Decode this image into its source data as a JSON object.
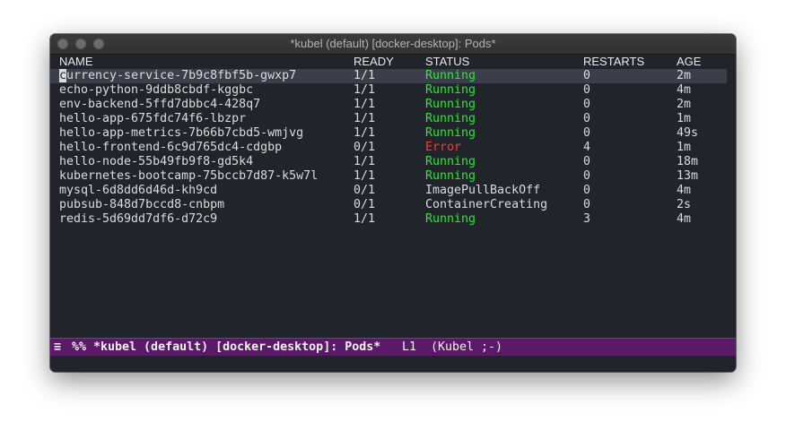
{
  "window": {
    "title": "*kubel (default) [docker-desktop]: Pods*"
  },
  "table": {
    "headers": {
      "name": "NAME",
      "ready": "READY",
      "status": "STATUS",
      "restarts": "RESTARTS",
      "age": "AGE"
    },
    "rows": [
      {
        "name_cursor": "c",
        "name_rest": "urrency-service-7b9c8fbf5b-gwxp7",
        "ready": "1/1",
        "status": "Running",
        "restarts": "0",
        "age": "2m"
      },
      {
        "name": "echo-python-9ddb8cbdf-kggbc",
        "ready": "1/1",
        "status": "Running",
        "restarts": "0",
        "age": "4m"
      },
      {
        "name": "env-backend-5ffd7dbbc4-428q7",
        "ready": "1/1",
        "status": "Running",
        "restarts": "0",
        "age": "2m"
      },
      {
        "name": "hello-app-675fdc74f6-lbzpr",
        "ready": "1/1",
        "status": "Running",
        "restarts": "0",
        "age": "1m"
      },
      {
        "name": "hello-app-metrics-7b66b7cbd5-wmjvg",
        "ready": "1/1",
        "status": "Running",
        "restarts": "0",
        "age": "49s"
      },
      {
        "name": "hello-frontend-6c9d765dc4-cdgbp",
        "ready": "0/1",
        "status": "Error",
        "restarts": "4",
        "age": "1m"
      },
      {
        "name": "hello-node-55b49fb9f8-gd5k4",
        "ready": "1/1",
        "status": "Running",
        "restarts": "0",
        "age": "18m"
      },
      {
        "name": "kubernetes-bootcamp-75bccb7d87-k5w7l",
        "ready": "1/1",
        "status": "Running",
        "restarts": "0",
        "age": "13m"
      },
      {
        "name": "mysql-6d8dd6d46d-kh9cd",
        "ready": "0/1",
        "status": "ImagePullBackOff",
        "restarts": "0",
        "age": "4m"
      },
      {
        "name": "pubsub-848d7bccd8-cnbpm",
        "ready": "0/1",
        "status": "ContainerCreating",
        "restarts": "0",
        "age": "2s"
      },
      {
        "name": "redis-5d69dd7df6-d72c9",
        "ready": "1/1",
        "status": "Running",
        "restarts": "3",
        "age": "4m"
      }
    ]
  },
  "modeline": {
    "hamburger": "≡",
    "buffer": "%% *kubel (default) [docker-desktop]: Pods*",
    "line": "L1",
    "mode": "(Kubel ;-)"
  },
  "colors": {
    "background": "#21242b",
    "running": "#31e633",
    "error": "#ff3b30",
    "modeline": "#5a1a68"
  }
}
